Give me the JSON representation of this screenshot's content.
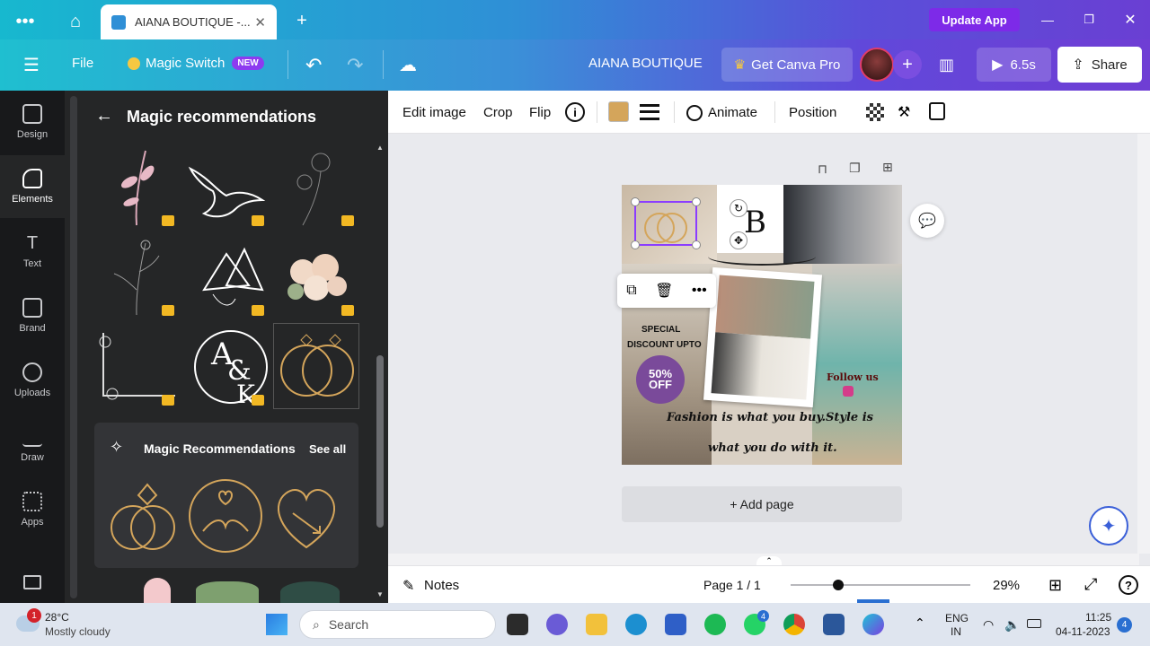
{
  "browser": {
    "tab_title": "AIANA BOUTIQUE -...",
    "update_app": "Update App"
  },
  "header": {
    "file": "File",
    "magic_switch": "Magic Switch",
    "new_badge": "NEW",
    "doc_title": "AIANA BOUTIQUE",
    "get_pro": "Get Canva Pro",
    "play_duration": "6.5s",
    "share": "Share"
  },
  "rail": [
    {
      "label": "Design",
      "icon": "layout-icon"
    },
    {
      "label": "Elements",
      "icon": "shapes-icon"
    },
    {
      "label": "Text",
      "icon": "text-icon"
    },
    {
      "label": "Brand",
      "icon": "brand-icon"
    },
    {
      "label": "Uploads",
      "icon": "upload-cloud-icon"
    },
    {
      "label": "Draw",
      "icon": "pen-icon"
    },
    {
      "label": "Apps",
      "icon": "grid-icon"
    }
  ],
  "panel": {
    "title": "Magic recommendations",
    "rec_card_title": "Magic Recommendations",
    "see_all": "See all"
  },
  "toolbar": {
    "edit_image": "Edit image",
    "crop": "Crop",
    "flip": "Flip",
    "animate": "Animate",
    "position": "Position",
    "color": "#d4a55b"
  },
  "design": {
    "special": "SPECIAL",
    "discount": "DISCOUNT UPTO",
    "off_line1": "50%",
    "off_line2": "OFF",
    "follow": "Follow us",
    "quote_line1": "Fashion is what you buy.Style is",
    "quote_line2": "what you do with it.",
    "monogram": "B",
    "add_page": "+ Add page"
  },
  "footer": {
    "notes": "Notes",
    "page": "Page 1 / 1",
    "zoom": "29%"
  },
  "taskbar": {
    "weather_temp": "28°C",
    "weather_desc": "Mostly cloudy",
    "weather_badge": "1",
    "search": "Search",
    "lang1": "ENG",
    "lang2": "IN",
    "time": "11:25",
    "date": "04-11-2023",
    "notif": "4",
    "whatsapp_badge": "4"
  }
}
